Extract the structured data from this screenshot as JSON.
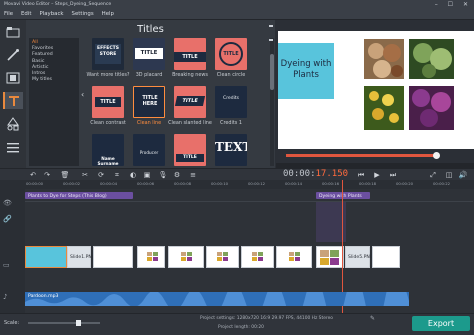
{
  "window": {
    "title": "Movavi Video Editor – Steps_Dyeing_Sequence",
    "controls": "–  ☐  ✕"
  },
  "menu": [
    "File",
    "Edit",
    "Playback",
    "Settings",
    "Help"
  ],
  "titles_panel": {
    "heading": "Titles",
    "categories": [
      "All",
      "Favorites",
      "Featured",
      "Basic",
      "Artistic",
      "Intros",
      "My titles"
    ],
    "selected_category": "All",
    "tiles": [
      {
        "label": "Want more titles?",
        "thumb": "EFFECTS STORE"
      },
      {
        "label": "3D placard",
        "thumb": "TITLE"
      },
      {
        "label": "Breaking news",
        "thumb": "TITLE"
      },
      {
        "label": "Clean circle",
        "thumb": "TITLE"
      },
      {
        "label": "Clean contrast",
        "thumb": "TITLE"
      },
      {
        "label": "Clean line",
        "thumb": "TITLE HERE"
      },
      {
        "label": "Clean slanted line",
        "thumb": "TITLE"
      },
      {
        "label": "Credits 1",
        "thumb": "Credits"
      },
      {
        "label": "",
        "thumb": "Name Surname"
      },
      {
        "label": "",
        "thumb": "Producer"
      },
      {
        "label": "",
        "thumb": "TITLE"
      },
      {
        "label": "",
        "thumb": "TEXT"
      }
    ]
  },
  "preview": {
    "title_text": "Dyeing with Plants",
    "accent_color": "#58c4dc"
  },
  "player": {
    "timecode_gray": "00:00:",
    "timecode_accent": "17.150"
  },
  "ruler_ticks": [
    "00:00:00",
    "00:00:02",
    "00:00:04",
    "00:00:06",
    "00:00:08",
    "00:00:10",
    "00:00:12",
    "00:00:14",
    "00:00:16",
    "00:00:18",
    "00:00:20",
    "00:00:22"
  ],
  "timeline": {
    "title_clip_1": "Plants to Dye for Steps (This Blog)",
    "title_clip_2": "Dyeing with Plants",
    "video_clip_label": "Slide1.PNG",
    "video_clip_label_2": "Slide5.PNG",
    "audio_label": "Pardoon.mp3"
  },
  "footer": {
    "scale_label": "Scale:",
    "project_settings": "Project settings:  1280x720 16:9 29.97 FPS, 44100 Hz Stereo",
    "project_length": "Project length:  00:20",
    "export_label": "Export"
  }
}
